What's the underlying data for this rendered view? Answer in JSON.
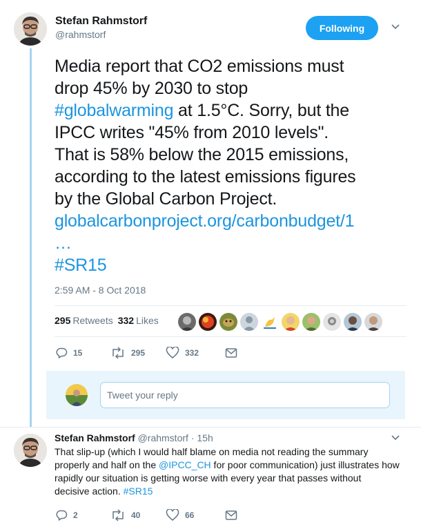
{
  "main_tweet": {
    "author_name": "Stefan Rahmstorf",
    "author_handle": "@rahmstorf",
    "follow_label": "Following",
    "text_lines": [
      {
        "a": "Media report that CO2 emissions must",
        "link": "",
        "b": ""
      },
      {
        "a": "drop 45% by 2030 to stop",
        "link": "",
        "b": ""
      },
      {
        "a": "",
        "link": "#globalwarming",
        "b": " at 1.5°C. Sorry, but the"
      },
      {
        "a": "IPCC writes \"45% from 2010 levels\".",
        "link": "",
        "b": ""
      },
      {
        "a": "That is 58% below the 2015 emissions,",
        "link": "",
        "b": ""
      },
      {
        "a": "according to the latest emissions figures",
        "link": "",
        "b": ""
      },
      {
        "a": "by the Global Carbon Project.",
        "link": "",
        "b": ""
      },
      {
        "a": "",
        "link": "globalcarbonproject.org/carbonbudget/1",
        "b": ""
      },
      {
        "a": "",
        "link": "…",
        "b": ""
      },
      {
        "a": "",
        "link": "#SR15",
        "b": ""
      }
    ],
    "timestamp": "2:59 AM - 8 Oct 2018",
    "retweets_count": "295",
    "retweets_label": "Retweets",
    "likes_count": "332",
    "likes_label": "Likes",
    "actions": {
      "replies": "15",
      "retweets": "295",
      "likes": "332"
    }
  },
  "reply_box": {
    "placeholder": "Tweet your reply"
  },
  "reply_tweet": {
    "author_name": "Stefan Rahmstorf",
    "author_handle": "@rahmstorf",
    "dot": "·",
    "age": "15h",
    "line1": "That slip-up (which I would half blame on media not reading the summary",
    "line2_a": "properly and half on the ",
    "line2_link": "@IPCC_CH",
    "line2_b": " for poor communication) just illustrates how",
    "line3": "rapidly our situation is getting worse with every year that passes without",
    "line4_a": "decisive action. ",
    "line4_link": "#SR15",
    "actions": {
      "replies": "2",
      "retweets": "40",
      "likes": "66"
    }
  },
  "colors": {
    "accent": "#1da1f2",
    "link": "#1b95e0",
    "muted": "#657786",
    "thread_line": "#a6d3f2",
    "reply_bg": "#e8f5fd"
  },
  "icons": [
    "chevron-down-icon",
    "reply-icon",
    "retweet-icon",
    "heart-icon",
    "message-icon"
  ]
}
